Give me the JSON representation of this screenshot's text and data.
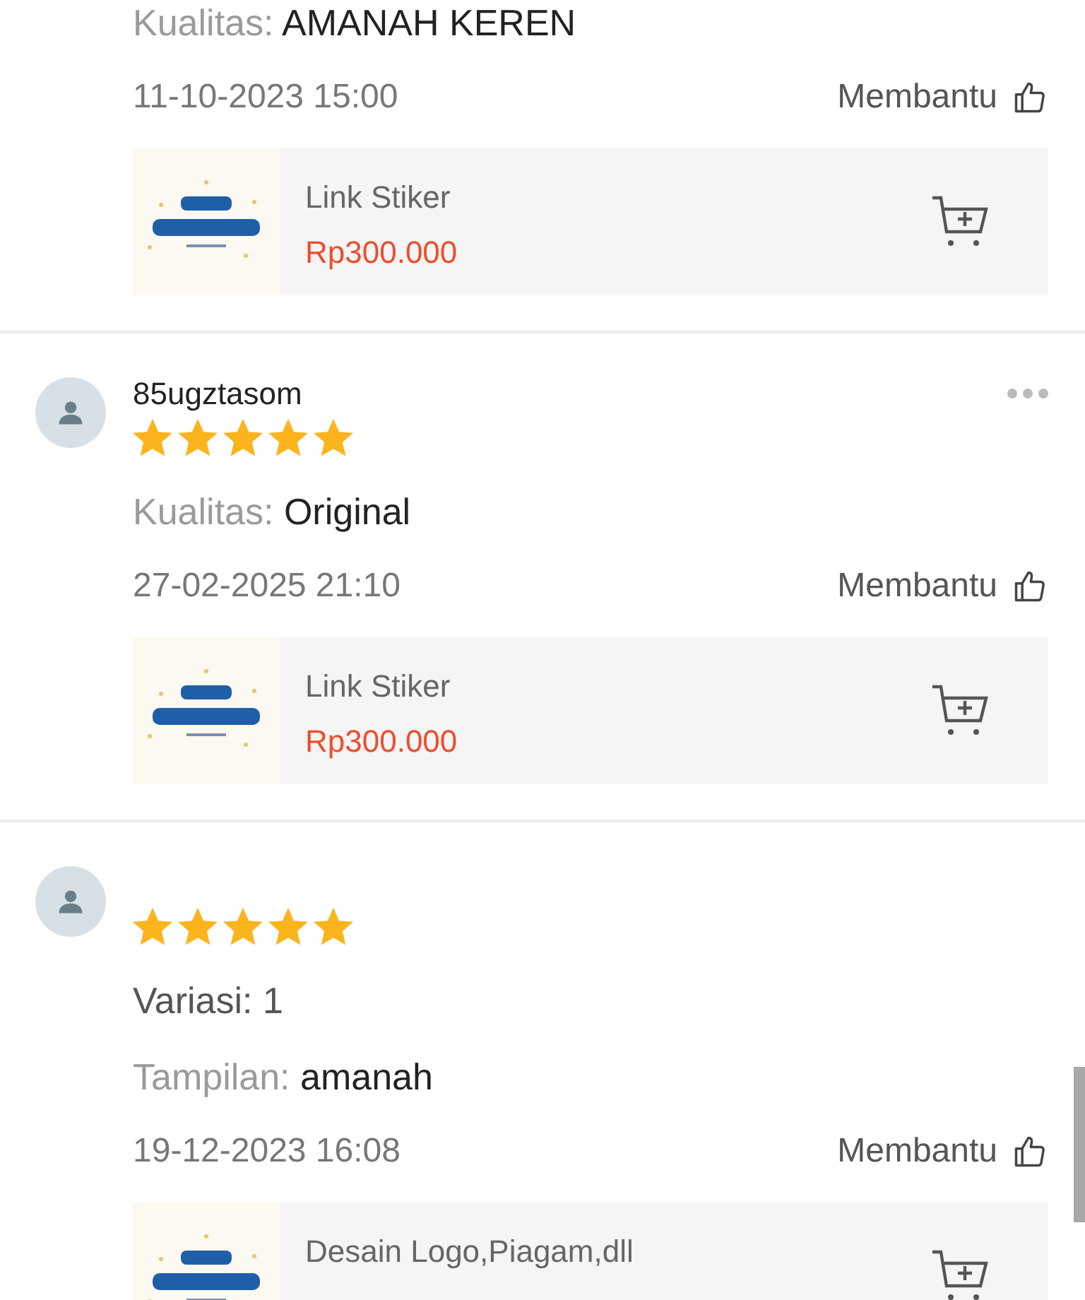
{
  "reviews": [
    {
      "attributes": [
        {
          "label": "Kualitas:",
          "value": "AMANAH KEREN"
        }
      ],
      "date": "11-10-2023 15:00",
      "helpful": "Membantu",
      "product": {
        "name": "Link Stiker",
        "price": "Rp300.000"
      }
    },
    {
      "username": "85ugztasom",
      "more_menu": true,
      "stars": 5,
      "attributes": [
        {
          "label": "Kualitas:",
          "value": "Original"
        }
      ],
      "date": "27-02-2025 21:10",
      "helpful": "Membantu",
      "product": {
        "name": "Link Stiker",
        "price": "Rp300.000"
      }
    },
    {
      "stars": 5,
      "attributes": [
        {
          "value": "Variasi: 1"
        },
        {
          "label": "Tampilan:",
          "value": "amanah"
        }
      ],
      "date": "19-12-2023 16:08",
      "helpful": "Membantu",
      "product": {
        "name": "Desain Logo,Piagam,dll"
      }
    }
  ]
}
